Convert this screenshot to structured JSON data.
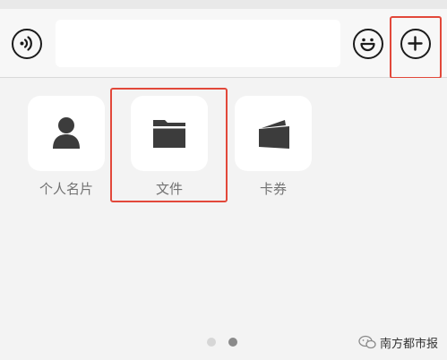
{
  "input_bar": {
    "voice_icon": "voice-wave-icon",
    "text_value": "",
    "emoji_icon": "smiley-icon",
    "plus_icon": "plus-circle-icon"
  },
  "panel": {
    "items": [
      {
        "label": "个人名片",
        "icon": "person-icon"
      },
      {
        "label": "文件",
        "icon": "folder-icon"
      },
      {
        "label": "卡券",
        "icon": "wallet-card-icon"
      }
    ],
    "page_indicator": {
      "pages": 2,
      "current": 2
    }
  },
  "watermark": {
    "text": "南方都市报",
    "icon": "wechat-icon"
  },
  "colors": {
    "highlight": "#e2483a",
    "icon_dark": "#1b1b1b",
    "label_gray": "#727272",
    "tile_bg": "#ffffff",
    "panel_bg": "#f3f3f3"
  }
}
